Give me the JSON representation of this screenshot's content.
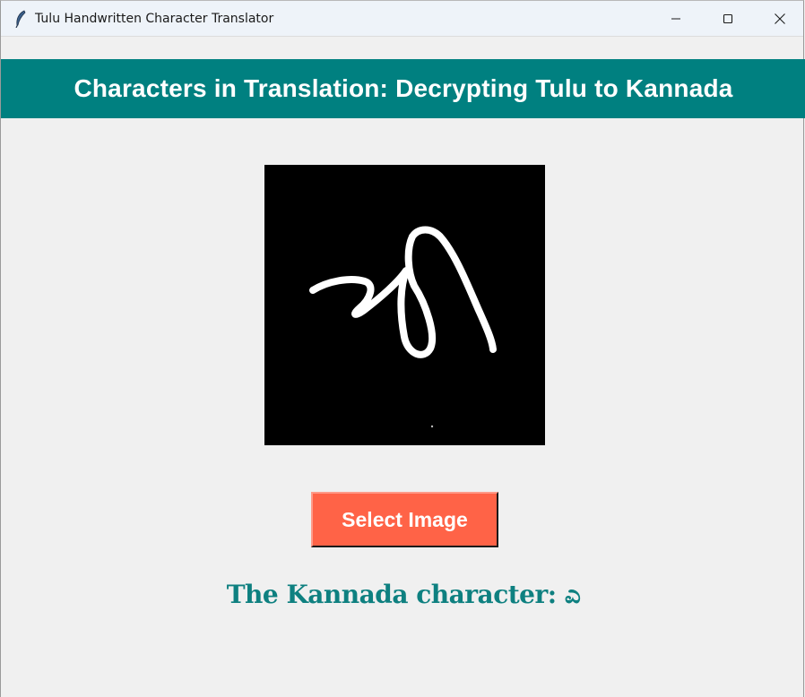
{
  "window": {
    "title": "Tulu Handwritten Character Translator",
    "icon": "feather-icon",
    "controls": {
      "minimize_icon": "minimize-icon",
      "maximize_icon": "maximize-icon",
      "close_icon": "close-icon"
    }
  },
  "header": {
    "title": "Characters in Translation: Decrypting Tulu to Kannada",
    "background_color": "#008080",
    "text_color": "#ffffff"
  },
  "preview": {
    "background_color": "#000000",
    "stroke_color": "#ffffff"
  },
  "actions": {
    "select_label": "Select Image",
    "select_color": "#ff6347"
  },
  "result": {
    "text": "The Kannada character: ಎ",
    "color": "#0e8080"
  }
}
